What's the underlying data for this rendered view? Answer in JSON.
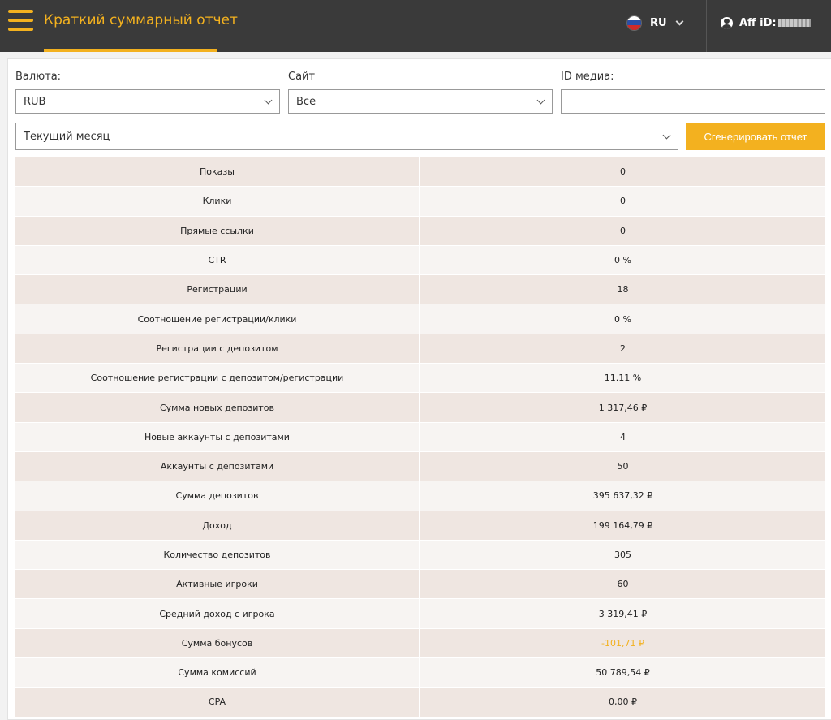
{
  "header": {
    "title": "Краткий суммарный отчет",
    "lang": "RU",
    "aff_label": "Aff iD:"
  },
  "filters": {
    "currency_label": "Валюта:",
    "currency_value": "RUB",
    "site_label": "Сайт",
    "site_value": "Все",
    "media_label": "ID медиа:",
    "media_value": "",
    "period_value": "Текущий месяц",
    "generate_label": "Сгенерировать отчет"
  },
  "colors": {
    "accent": "#f3b11f",
    "topbar": "#3a3a3a"
  },
  "stats": [
    {
      "name": "Показы",
      "value": "0"
    },
    {
      "name": "Клики",
      "value": "0"
    },
    {
      "name": "Прямые ссылки",
      "value": "0"
    },
    {
      "name": "CTR",
      "value": "0 %"
    },
    {
      "name": "Регистрации",
      "value": "18"
    },
    {
      "name": "Соотношение регистрации/клики",
      "value": "0 %"
    },
    {
      "name": "Регистрации с депозитом",
      "value": "2"
    },
    {
      "name": "Соотношение регистрации с депозитом/регистрации",
      "value": "11.11 %"
    },
    {
      "name": "Сумма новых депозитов",
      "value": "1 317,46 ₽"
    },
    {
      "name": "Новые аккаунты с депозитами",
      "value": "4"
    },
    {
      "name": "Аккаунты с депозитами",
      "value": "50"
    },
    {
      "name": "Сумма депозитов",
      "value": "395 637,32 ₽"
    },
    {
      "name": "Доход",
      "value": "199 164,79 ₽"
    },
    {
      "name": "Количество депозитов",
      "value": "305"
    },
    {
      "name": "Активные игроки",
      "value": "60"
    },
    {
      "name": "Средний доход с игрока",
      "value": "3 319,41 ₽"
    },
    {
      "name": "Сумма бонусов",
      "value": "-101,71 ₽"
    },
    {
      "name": "Сумма комиссий",
      "value": "50 789,54 ₽"
    },
    {
      "name": "CPA",
      "value": "0,00 ₽"
    }
  ]
}
